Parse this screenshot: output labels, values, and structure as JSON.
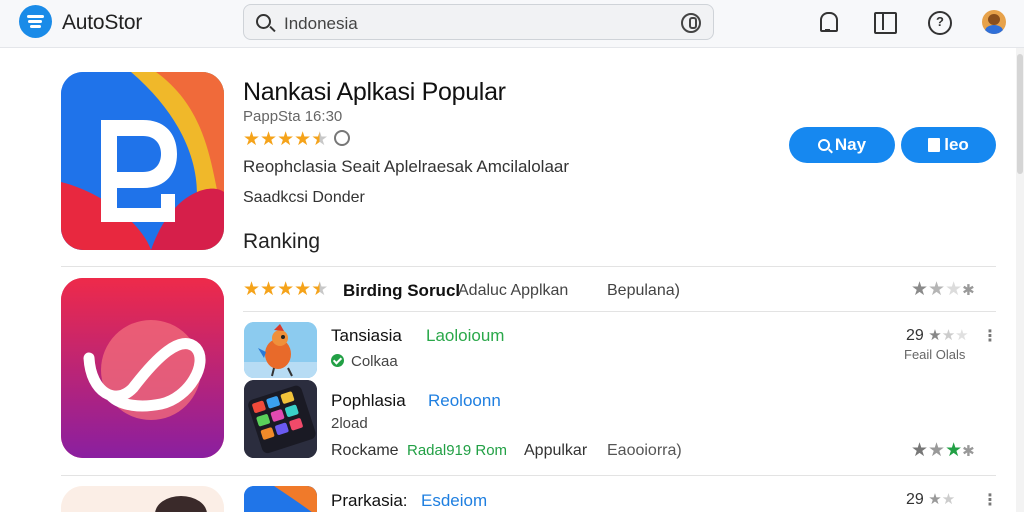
{
  "topbar": {
    "app_name": "AutoStor",
    "search_value": "Indonesia"
  },
  "featured": {
    "title": "Nankasi Aplkasi Popular",
    "meta": "PappSta 16:30",
    "rating_icon": "info-circle-icon",
    "description": "Reophclasia Seait Aplelraesak Amcilalolaar",
    "developer": "Saadkcsi Donder",
    "play_label": "Nay",
    "view_label": "leo"
  },
  "ranking": {
    "heading": "Ranking",
    "header_bold": "Birding Sorucl",
    "header_mid": "Adaluc Applkan",
    "header_right": "Bepulana)",
    "items": [
      {
        "name": "Tansiasia",
        "tag": "Laoloioum",
        "tag_color": "#2aa84a",
        "sub": "Colkaa",
        "score": "29",
        "score_sub": "Feail Olals"
      },
      {
        "name": "Pophlasia",
        "tag": "Reoloonn",
        "tag_color": "#1f7fe0"
      }
    ],
    "bottom": {
      "name": "Rockame",
      "tag": "Radal919 Rom",
      "mid": "Appulkar",
      "right": "Eaooiorra)"
    },
    "peek": {
      "name": "Prarkasia:",
      "tag": "Esdeiom",
      "tag_color": "#1f7fe0",
      "score": "29"
    }
  },
  "colors": {
    "accent": "#1688f0",
    "star": "#f5a31a",
    "green": "#22a045"
  }
}
